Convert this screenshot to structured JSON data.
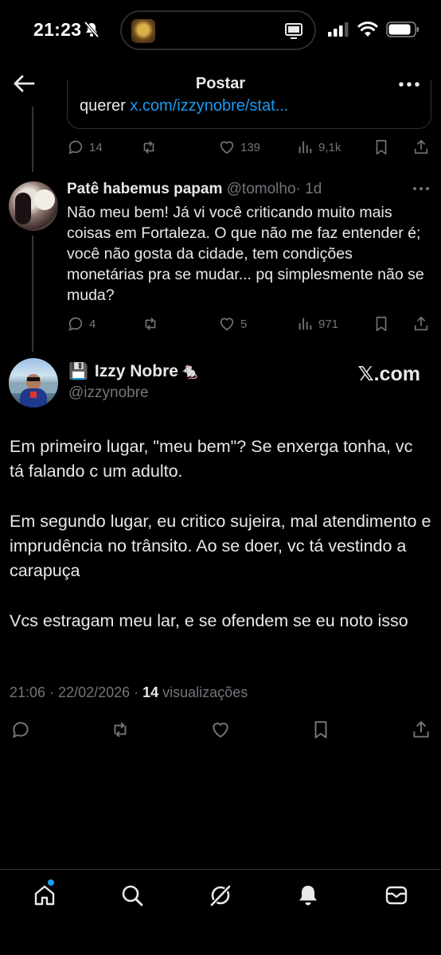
{
  "status_bar": {
    "time": "21:23"
  },
  "header": {
    "title": "Postar"
  },
  "quoted": {
    "prefix": "querer ",
    "link": "x.com/izzynobre/stat..."
  },
  "parent_actions": {
    "replies": "14",
    "reposts": "",
    "likes": "139",
    "views": "9,1k"
  },
  "reply": {
    "name": "Patê habemus papam",
    "handle": "@tomolho",
    "time": "· 1d",
    "text": "Não meu bem! Já vi você criticando muito mais coisas em Fortaleza. O que não me faz entender é; você não gosta da cidade, tem condições monetárias pra se mudar... pq simplesmente não se muda?",
    "replies": "4",
    "likes": "5",
    "views": "971"
  },
  "main_tweet": {
    "emoji_prefix": "💾",
    "name": "Izzy Nobre",
    "emoji_suffix": "🐁",
    "handle": "@izzynobre",
    "source_logo": "𝕏.com",
    "paragraphs": [
      "Em primeiro lugar, \"meu bem\"? Se enxerga tonha, vc tá falando c um adulto.",
      "Em segundo lugar, eu critico sujeira, mal atendimento e imprudência no trânsito. Ao se doer, vc tá vestindo a carapuça",
      "Vcs estragam meu lar, e se ofendem se eu noto isso"
    ],
    "timestamp": "21:06 · 22/02/2026 · ",
    "views_count": "14",
    "views_label": " visualizações"
  },
  "nav": [
    "home-icon",
    "search-icon",
    "grok-icon",
    "notifications-icon",
    "messages-icon"
  ],
  "colors": {
    "accent": "#1d9bf0",
    "muted": "#71767b",
    "text": "#e7e9ea",
    "divider": "#2f3336"
  }
}
